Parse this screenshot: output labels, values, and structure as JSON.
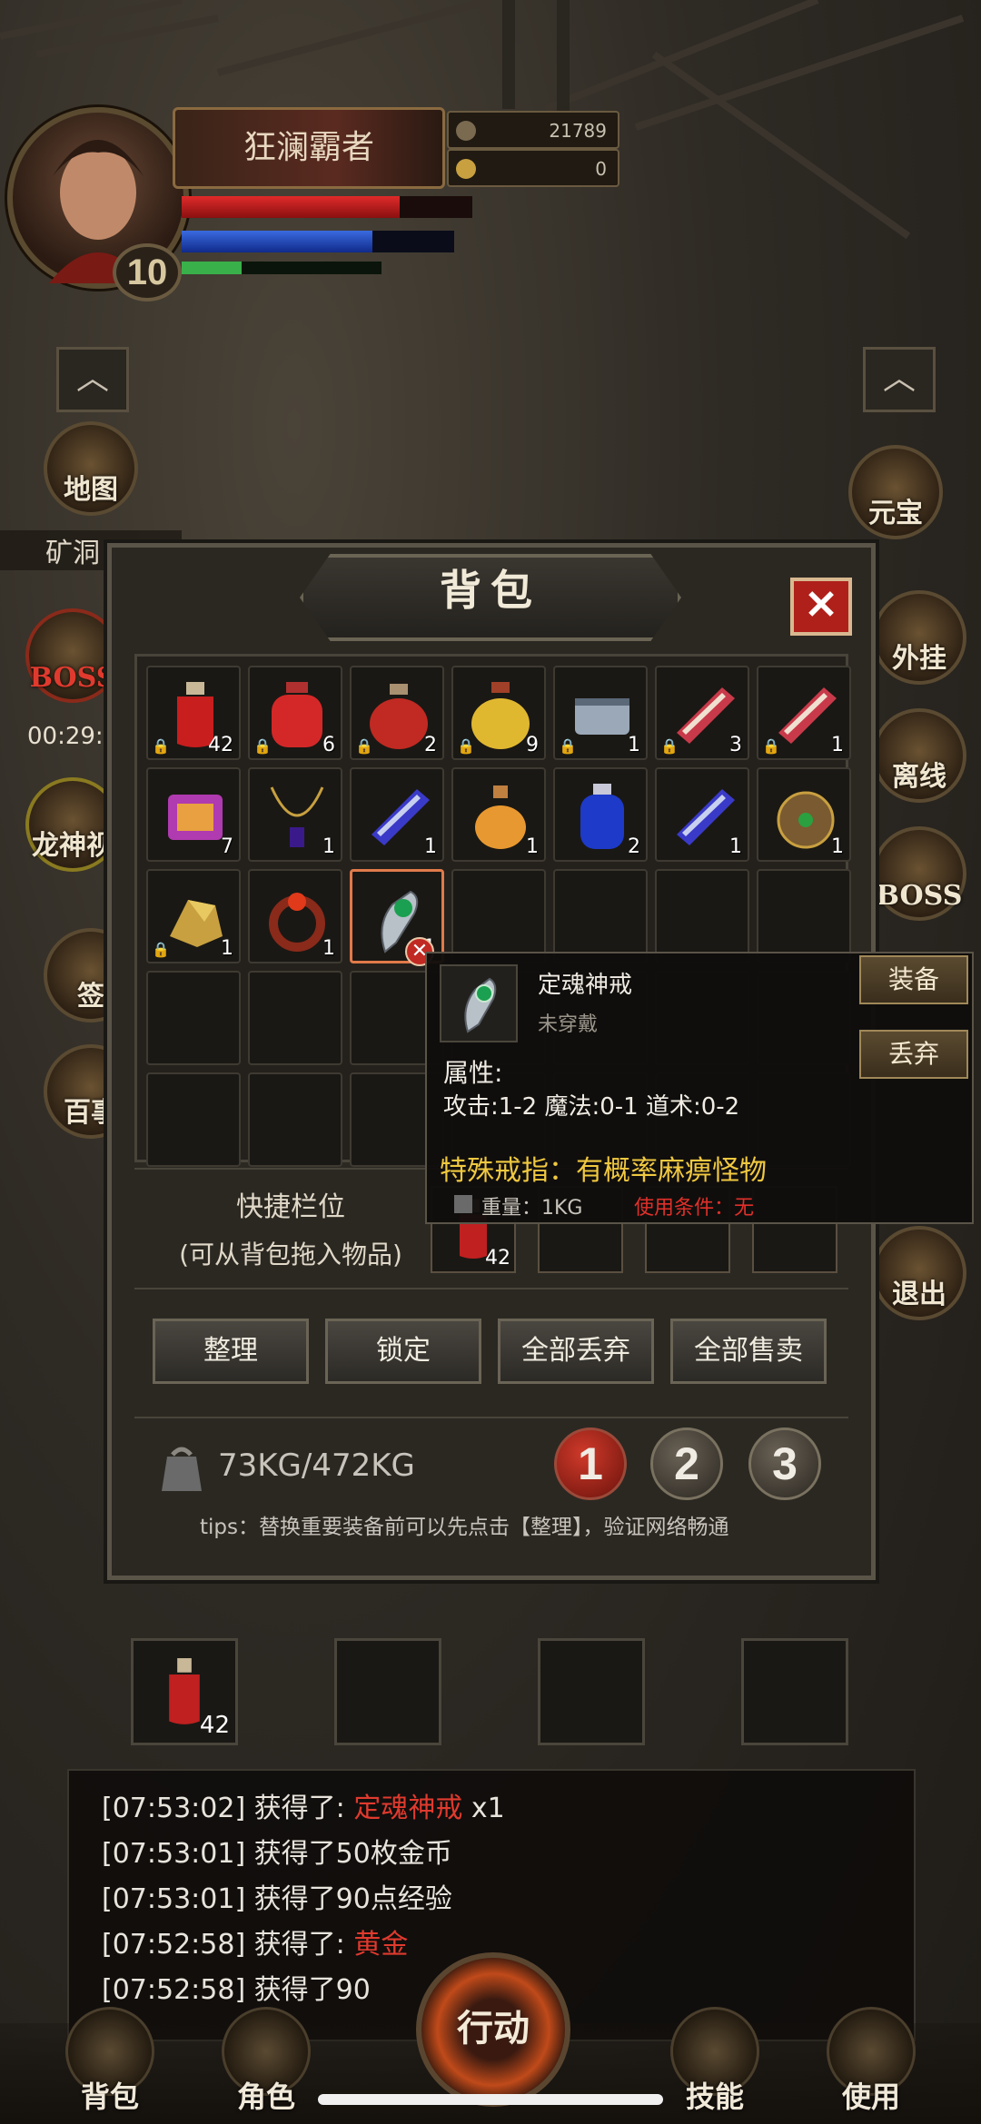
{
  "player": {
    "name": "狂澜霸者",
    "level": "10",
    "gold": "21789",
    "ingot": "0",
    "hp_fraction": 0.75,
    "mp_fraction": 0.7,
    "exp_fraction": 0.3
  },
  "left_menu": {
    "map": "地图",
    "mine": "矿洞",
    "boss_label": "BOSS",
    "boss_timer": "00:29:",
    "dragon": "龙神视",
    "signin": "签",
    "misc": "百事"
  },
  "right_menu": {
    "yuanbao": "元宝",
    "plugin": "外挂",
    "offline": "离线",
    "boss": "BOSS",
    "quit": "退出"
  },
  "bag": {
    "title": "背包",
    "close": "✕",
    "items": [
      {
        "icon": "red-potion-icon",
        "count": "42",
        "locked": true
      },
      {
        "icon": "red-flask-icon",
        "count": "6",
        "locked": true
      },
      {
        "icon": "red-jar-icon",
        "count": "2",
        "locked": true
      },
      {
        "icon": "gold-potion-icon",
        "count": "9",
        "locked": true
      },
      {
        "icon": "scroll-icon",
        "count": "1",
        "locked": true
      },
      {
        "icon": "red-book-icon",
        "count": "3",
        "locked": true
      },
      {
        "icon": "red-book-icon",
        "count": "1",
        "locked": true
      },
      {
        "icon": "purple-scroll-icon",
        "count": "7",
        "locked": false
      },
      {
        "icon": "necklace-icon",
        "count": "1",
        "locked": false
      },
      {
        "icon": "blue-book-icon",
        "count": "1",
        "locked": false
      },
      {
        "icon": "orange-potion-icon",
        "count": "1",
        "locked": false
      },
      {
        "icon": "blue-potion-icon",
        "count": "2",
        "locked": false
      },
      {
        "icon": "blue-book-icon",
        "count": "1",
        "locked": false
      },
      {
        "icon": "amulet-icon",
        "count": "1",
        "locked": false
      },
      {
        "icon": "gold-ore-icon",
        "count": "1",
        "locked": true
      },
      {
        "icon": "ring-icon",
        "count": "1",
        "locked": false
      },
      {
        "icon": "green-ring-icon",
        "count": "1",
        "locked": false
      }
    ],
    "quick_label": "快捷栏位",
    "quick_hint": "(可从背包拖入物品)",
    "quick_count": "42",
    "actions": [
      "整理",
      "锁定",
      "全部丢弃",
      "全部售卖"
    ],
    "weight": "73KG/472KG",
    "pages": [
      "1",
      "2",
      "3"
    ],
    "tips": "tips：替换重要装备前可以先点击【整理】，验证网络畅通"
  },
  "tooltip": {
    "name": "定魂神戒",
    "state": "未穿戴",
    "attr_title": "属性:",
    "stats": "攻击:1-2  魔法:0-1  道术:0-2",
    "special": "特殊戒指：有概率麻痹怪物",
    "weight": "重量：1KG",
    "condition": "使用条件：无",
    "equip": "装备",
    "discard": "丢弃"
  },
  "hotbar": {
    "count": "42"
  },
  "log": [
    {
      "time": "[07:53:02]",
      "text": "获得了: ",
      "hl": "定魂神戒",
      "tail": " x1"
    },
    {
      "time": "[07:53:01]",
      "text": "获得了50枚金币",
      "hl": "",
      "tail": ""
    },
    {
      "time": "[07:53:01]",
      "text": "获得了90点经验",
      "hl": "",
      "tail": ""
    },
    {
      "time": "[07:52:58]",
      "text": "获得了: ",
      "hl": "黄金",
      "tail": ""
    },
    {
      "time": "[07:52:58]",
      "text": "获得了90",
      "hl": "",
      "tail": ""
    }
  ],
  "nav": {
    "bag": "背包",
    "role": "角色",
    "action": "行动",
    "skill": "技能",
    "use": "使用"
  }
}
